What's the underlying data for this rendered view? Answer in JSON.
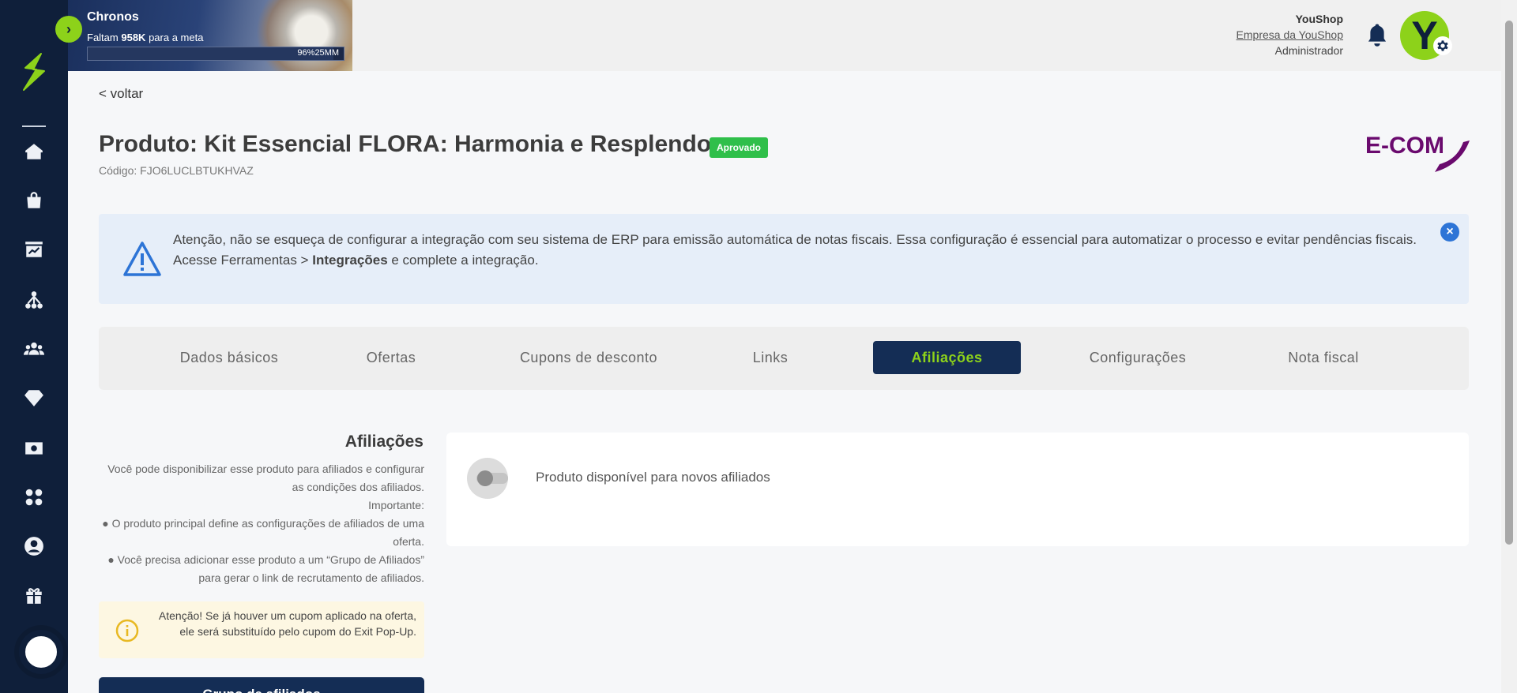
{
  "chronos": {
    "title": "Chronos",
    "subtitle_prefix": "Faltam",
    "subtitle_value": "958K",
    "subtitle_suffix": "para a meta",
    "progress_percent": 96,
    "progress_text": "96%25MM"
  },
  "user": {
    "name": "YouShop",
    "company": "Empresa da YouShop",
    "role": "Administrador",
    "avatar_letter": "Y"
  },
  "colors": {
    "sidebar": "#0f1f3a",
    "accent": "#8dd21a",
    "tab_active": "#142d55",
    "badge_green": "#2fbf4a",
    "brand_purple": "#6a0a6e"
  },
  "sidebar": {
    "icons": [
      "home-icon",
      "shopping-bag-icon",
      "dashboard-chart-icon",
      "network-icon",
      "users-group-icon",
      "diamond-icon",
      "money-icon",
      "apps-grid-icon",
      "user-circle-icon",
      "gift-icon"
    ]
  },
  "page": {
    "back_label": "< voltar",
    "title": "Produto: Kit Essencial FLORA: Harmonia e Resplendor",
    "status": "Aprovado",
    "code": "Código: FJO6LUCLBTUKHVAZ",
    "brand_logo_text": "E-COM"
  },
  "alert": {
    "line1": "Atenção, não se esqueça de configurar a integração com seu sistema de ERP para emissão automática de notas fiscais. Essa configuração é essencial para automatizar o processo e evitar pendências fiscais.",
    "line2_prefix": "Acesse Ferramentas > ",
    "line2_bold": "Integrações",
    "line2_suffix": " e complete a integração."
  },
  "tabs": [
    {
      "label": "Dados básicos"
    },
    {
      "label": "Ofertas"
    },
    {
      "label": "Cupons de desconto"
    },
    {
      "label": "Links"
    },
    {
      "label": "Afiliações",
      "active": true
    },
    {
      "label": "Configurações"
    },
    {
      "label": "Nota fiscal"
    }
  ],
  "affiliations": {
    "title": "Afiliações",
    "desc1": "Você pode disponibilizar esse produto para afiliados e configurar as condições dos afiliados.",
    "desc2": "Importante:",
    "desc3": "● O produto principal define as configurações de afiliados de uma oferta.",
    "desc4": "● Você precisa adicionar esse produto a um “Grupo de Afiliados” para gerar o link de recrutamento de afiliados.",
    "warning": "Atenção! Se já houver um cupom aplicado na oferta, ele será substituído pelo cupom do Exit Pop-Up.",
    "create_button": "Grupo de afiliados",
    "toggle_label": "Produto disponível para novos afiliados",
    "toggle_on": false
  }
}
